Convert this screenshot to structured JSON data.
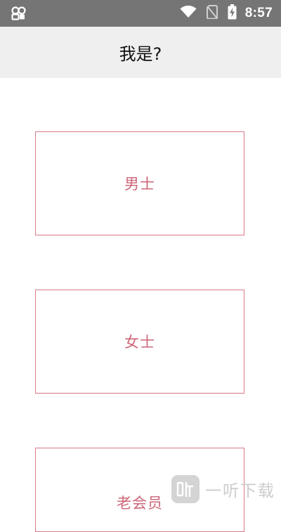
{
  "status_bar": {
    "time": "8:57",
    "icons": [
      "notification-icon",
      "wifi-icon",
      "no-sim-icon",
      "battery-charging-icon"
    ]
  },
  "app_bar": {
    "title": "我是?"
  },
  "options": [
    {
      "label": "男士"
    },
    {
      "label": "女士"
    },
    {
      "label": "老会员"
    }
  ],
  "watermark": {
    "text": "一听下载"
  },
  "colors": {
    "status_bar_bg": "#757575",
    "app_bar_bg": "#efefef",
    "accent": "#cc6677",
    "card_border": "#d97a88"
  }
}
